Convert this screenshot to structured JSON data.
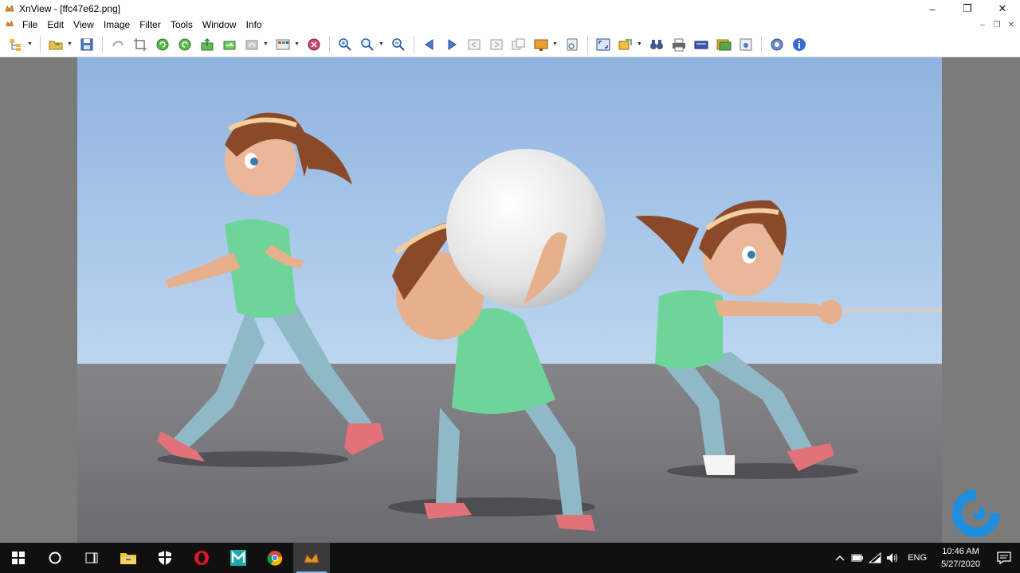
{
  "window": {
    "title": "XnView - [ffc47e62.png]",
    "controls": {
      "minimize": "–",
      "restore": "❐",
      "close": "✕"
    }
  },
  "menu": {
    "items": [
      "File",
      "Edit",
      "View",
      "Image",
      "Filter",
      "Tools",
      "Window",
      "Info"
    ],
    "doc_controls": {
      "minimize": "–",
      "restore": "❐",
      "close": "✕"
    }
  },
  "toolbar": {
    "buttons": [
      "browser-tree-icon",
      "open-folder-icon",
      "save-icon",
      "undo-icon",
      "crop-icon",
      "rotate-left-icon",
      "rotate-right-icon",
      "export-icon",
      "send-icon",
      "web-export-icon",
      "adjust-icon",
      "slideshow-icon",
      "zoom-in-icon",
      "zoom-icon",
      "zoom-out-icon",
      "previous-icon",
      "next-icon",
      "first-icon",
      "last-icon",
      "fit-icon",
      "set-wallpaper-icon",
      "capture-icon",
      "fullscreen-icon",
      "convert-icon",
      "binoculars-icon",
      "print-icon",
      "scan-icon",
      "slideshow-window-icon",
      "screenshot-icon",
      "settings-icon",
      "about-icon"
    ]
  },
  "viewer": {
    "image_description_icon": "picture",
    "background": "#7b7b7b"
  },
  "taskbar": {
    "apps": [
      "start-icon",
      "cortana-icon",
      "task-view-icon",
      "file-explorer-icon",
      "security-icon",
      "opera-icon",
      "maya-icon",
      "chrome-icon",
      "xnview-icon"
    ],
    "language": "ENG",
    "time": "10:46 AM",
    "date": "5/27/2020"
  }
}
